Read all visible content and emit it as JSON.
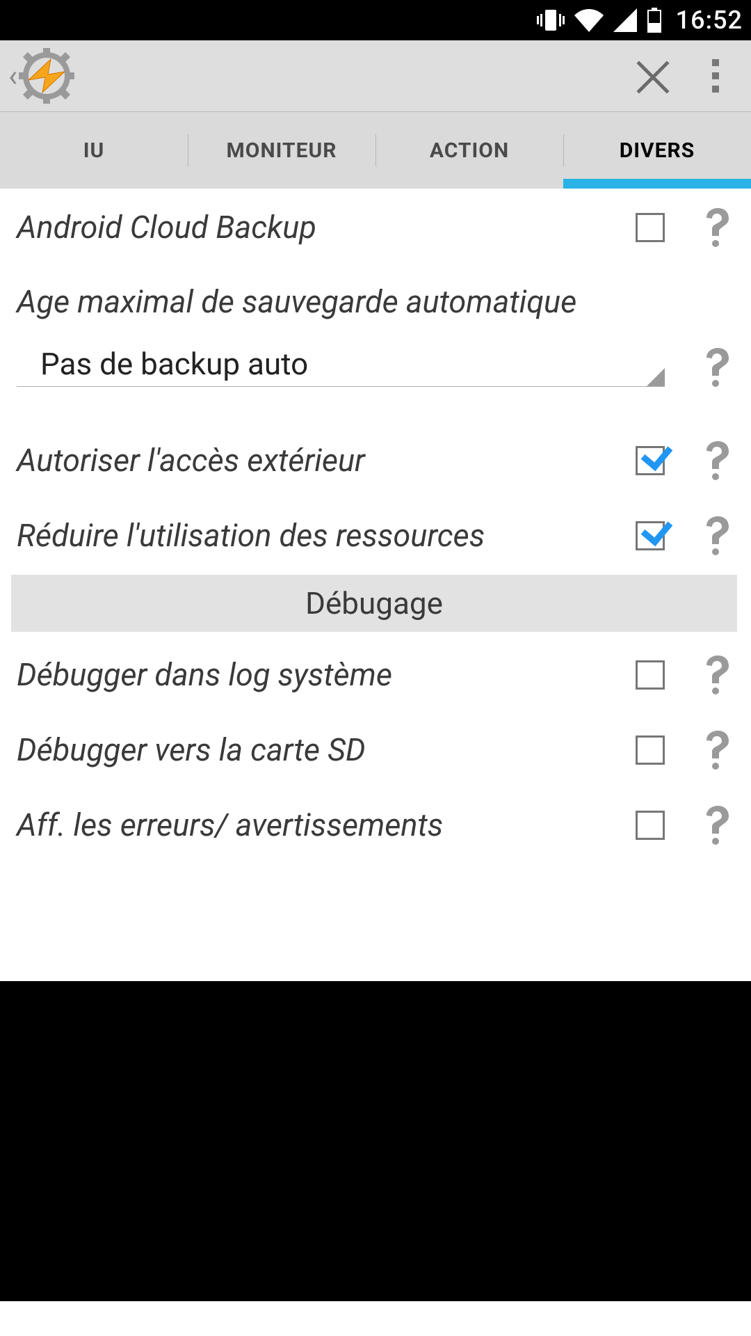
{
  "status_bar": {
    "time": "16:52"
  },
  "tabs": [
    "IU",
    "MONITEUR",
    "ACTION",
    "DIVERS"
  ],
  "active_tab_index": 3,
  "settings": {
    "cloud_backup": {
      "label": "Android Cloud Backup",
      "checked": false
    },
    "backup_age": {
      "label": "Age maximal de sauvegarde automatique",
      "value": "Pas de backup auto"
    },
    "external_access": {
      "label": "Autoriser l'accès extérieur",
      "checked": true
    },
    "reduce_resources": {
      "label": "Réduire l'utilisation des ressources",
      "checked": true
    },
    "debug_section": "Débugage",
    "debug_syslog": {
      "label": "Débugger dans log système",
      "checked": false
    },
    "debug_sd": {
      "label": "Débugger vers la carte SD",
      "checked": false
    },
    "show_errors": {
      "label": "Aff. les erreurs/ avertissements",
      "checked": false
    }
  }
}
